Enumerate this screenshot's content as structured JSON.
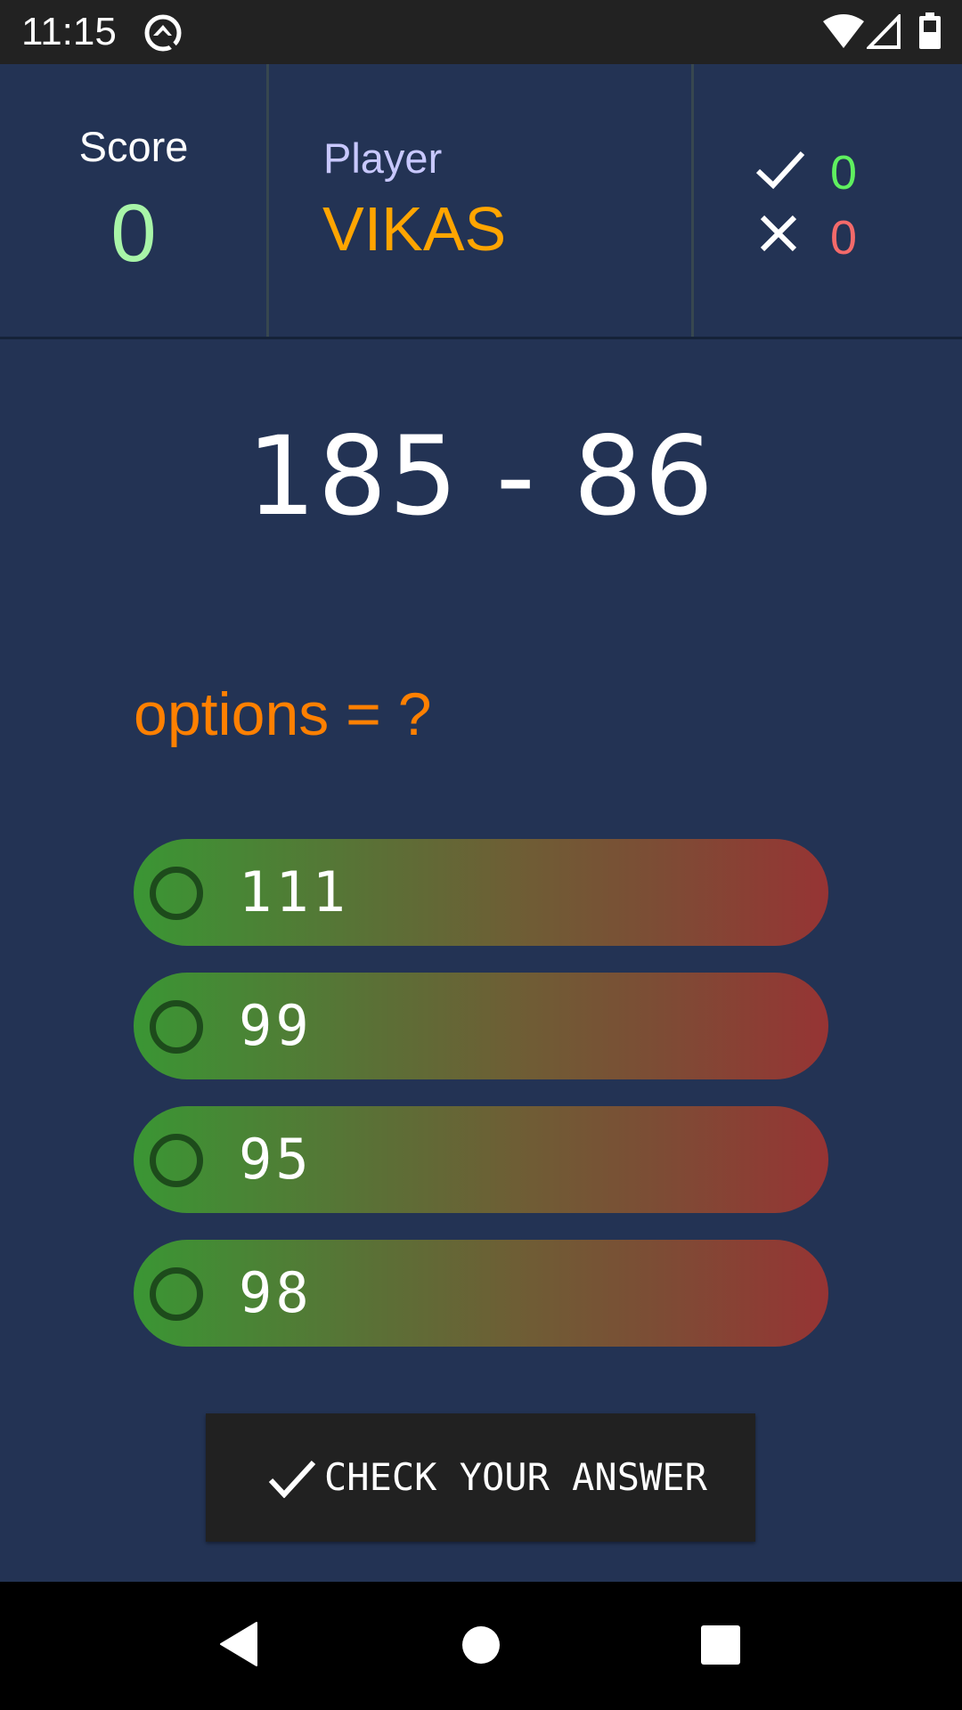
{
  "status_bar": {
    "time": "11:15",
    "icons": [
      "app-notification-icon",
      "wifi-icon",
      "cell-signal-icon",
      "battery-icon"
    ]
  },
  "header": {
    "score_label": "Score",
    "score_value": "0",
    "player_label": "Player",
    "player_name": "VIKAS",
    "correct_count": "0",
    "wrong_count": "0",
    "colors": {
      "score_value": "#a8f5a8",
      "player_label": "#c8c8ff",
      "player_name": "#ffa500",
      "correct_count": "#5ff05f",
      "wrong_count": "#f46a6a"
    }
  },
  "question": {
    "text": "185 - 86",
    "options_label": "options = ?"
  },
  "options": [
    {
      "label": "111",
      "selected": false
    },
    {
      "label": "99",
      "selected": false
    },
    {
      "label": "95",
      "selected": false
    },
    {
      "label": "98",
      "selected": false
    }
  ],
  "check_button": {
    "label": "CHECK YOUR ANSWER",
    "icon": "check-icon"
  },
  "nav_bar": {
    "icons": [
      "back-icon",
      "home-icon",
      "recents-icon"
    ]
  },
  "theme": {
    "background": "#233354",
    "option_gradient_start": "#3a9634",
    "option_gradient_end": "#963434",
    "accent_orange": "#ff8000"
  }
}
